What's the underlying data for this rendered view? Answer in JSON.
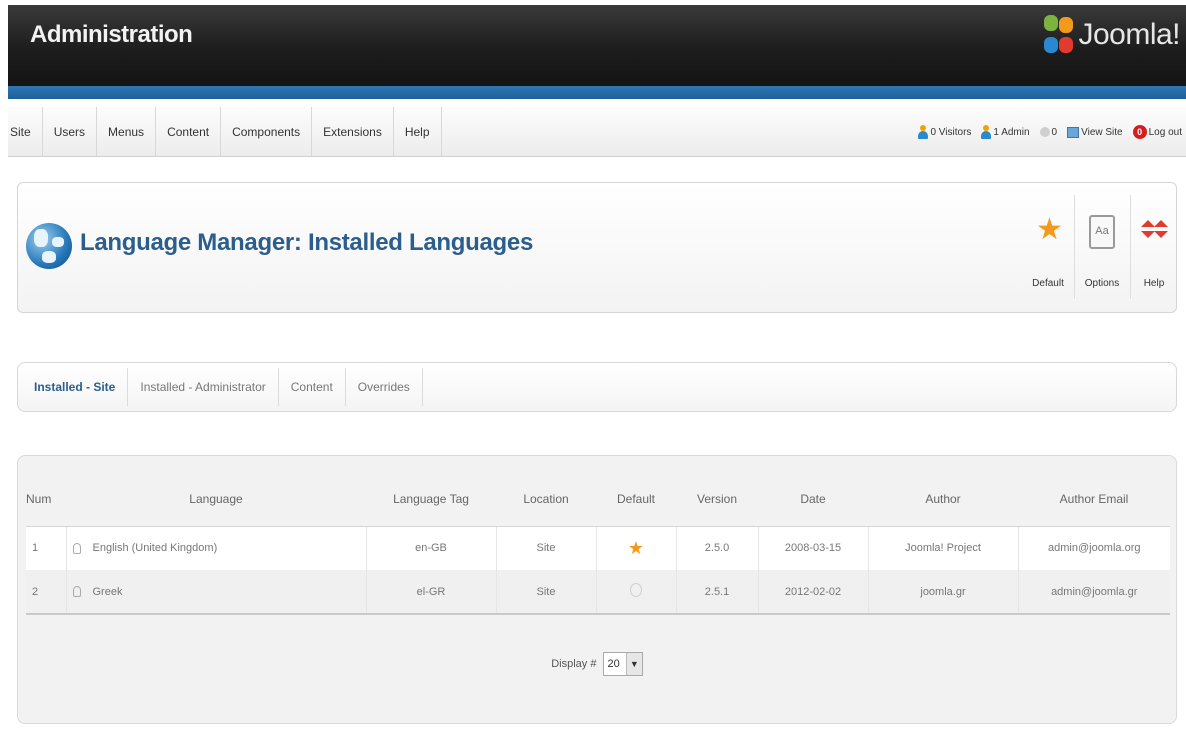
{
  "header": {
    "title": "Administration",
    "logo_text": "Joomla!"
  },
  "menu": {
    "items": [
      "Site",
      "Users",
      "Menus",
      "Content",
      "Components",
      "Extensions",
      "Help"
    ]
  },
  "status": {
    "visitors": "0 Visitors",
    "admins": "1 Admin",
    "messages": "0",
    "view_site": "View Site",
    "logout": "Log out"
  },
  "toolbar": {
    "page_title": "Language Manager: Installed Languages",
    "buttons": [
      {
        "label": "Default",
        "icon": "star-icon"
      },
      {
        "label": "Options",
        "icon": "options-icon"
      },
      {
        "label": "Help",
        "icon": "help-icon"
      }
    ]
  },
  "tabs": [
    {
      "label": "Installed - Site",
      "active": true
    },
    {
      "label": "Installed - Administrator",
      "active": false
    },
    {
      "label": "Content",
      "active": false
    },
    {
      "label": "Overrides",
      "active": false
    }
  ],
  "table": {
    "headers": [
      "Num",
      "Language",
      "Language Tag",
      "Location",
      "Default",
      "Version",
      "Date",
      "Author",
      "Author Email"
    ],
    "rows": [
      {
        "num": "1",
        "language": "English (United Kingdom)",
        "tag": "en-GB",
        "location": "Site",
        "default": true,
        "version": "2.5.0",
        "date": "2008-03-15",
        "author": "Joomla! Project",
        "email": "admin@joomla.org"
      },
      {
        "num": "2",
        "language": "Greek",
        "tag": "el-GR",
        "location": "Site",
        "default": false,
        "version": "2.5.1",
        "date": "2012-02-02",
        "author": "joomla.gr",
        "email": "admin@joomla.gr"
      }
    ]
  },
  "pagination": {
    "display_label": "Display #",
    "value": "20"
  },
  "colors": {
    "header_bg": "#1c1c1c",
    "strip_blue": "#2f77b3",
    "title_blue": "#2b5e8c",
    "star_orange": "#f39a1c",
    "logout_red": "#d21e1e"
  }
}
